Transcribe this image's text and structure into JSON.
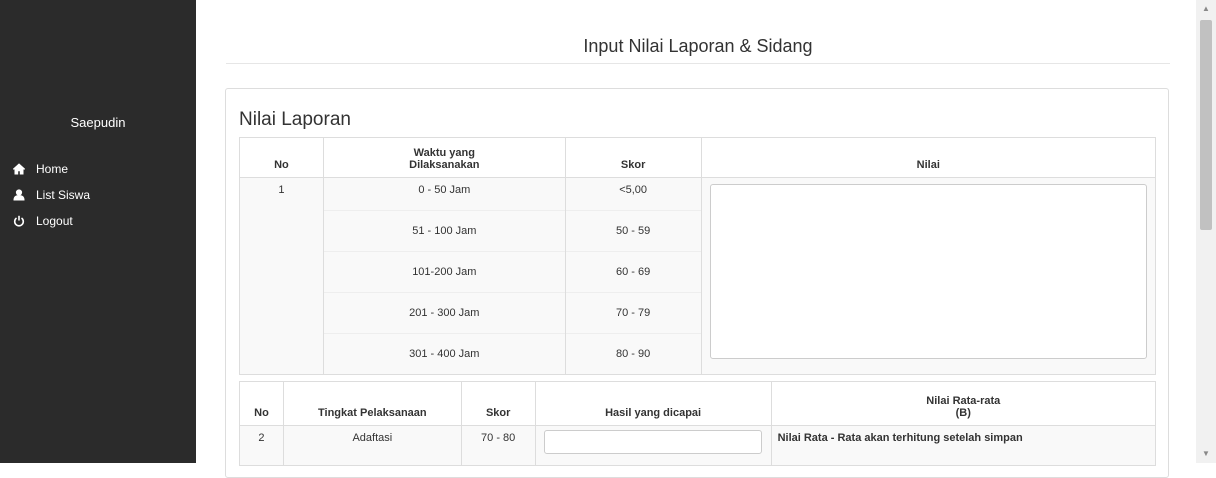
{
  "sidebar": {
    "user_name": "Saepudin",
    "items": [
      {
        "label": "Home",
        "icon": "home-icon"
      },
      {
        "label": "List Siswa",
        "icon": "user-icon"
      },
      {
        "label": "Logout",
        "icon": "power-icon"
      }
    ]
  },
  "page": {
    "title": "Input Nilai Laporan & Sidang"
  },
  "laporan": {
    "title": "Nilai Laporan",
    "headers": {
      "no": "No",
      "waktu": "Waktu yang Dilaksanakan",
      "skor": "Skor",
      "nilai": "Nilai"
    },
    "row_no": "1",
    "rows": [
      {
        "waktu": "0 - 50 Jam",
        "skor": "<5,00"
      },
      {
        "waktu": "51 - 100 Jam",
        "skor": "50 - 59"
      },
      {
        "waktu": "101-200 Jam",
        "skor": "60 - 69"
      },
      {
        "waktu": "201 - 300 Jam",
        "skor": "70 - 79"
      },
      {
        "waktu": "301 - 400 Jam",
        "skor": "80 - 90"
      }
    ],
    "nilai_value": ""
  },
  "pelaksanaan": {
    "headers": {
      "no": "No",
      "tingkat": "Tingkat Pelaksanaan",
      "skor": "Skor",
      "hasil": "Hasil yang dicapai",
      "rata": "Nilai Rata-rata",
      "rata_sub": "(B)"
    },
    "rows": [
      {
        "no": "2",
        "tingkat": "Adaftasi",
        "skor": "70 - 80",
        "hasil": "",
        "note": "Nilai Rata - Rata akan terhitung setelah simpan"
      }
    ]
  }
}
